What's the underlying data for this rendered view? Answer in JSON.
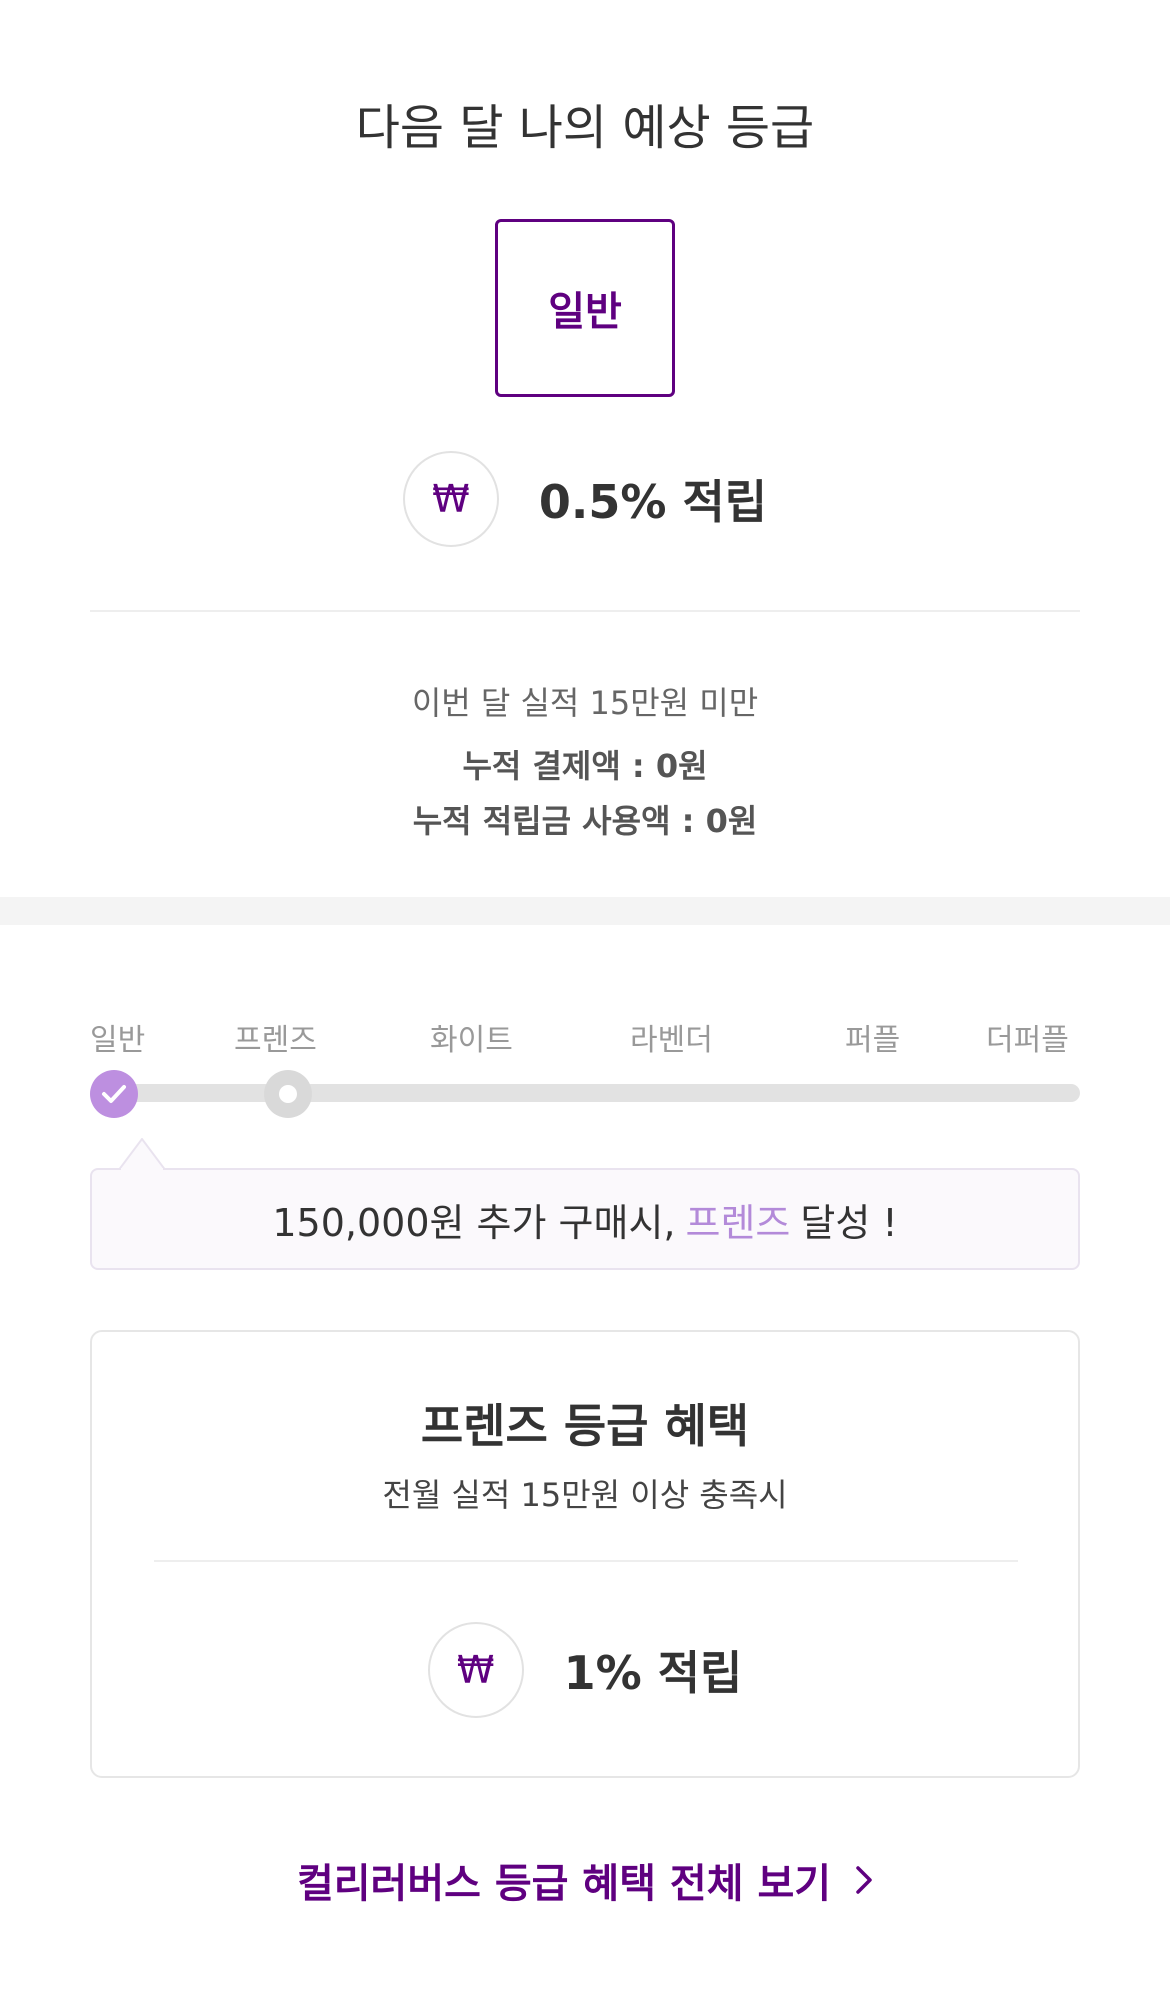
{
  "header": {
    "title": "다음 달 나의 예상 등급",
    "grade": "일반",
    "reward_icon": "won-icon",
    "reward_symbol": "₩",
    "reward_text": "0.5% 적립"
  },
  "summary": {
    "performance": "이번 달 실적 15만원 미만",
    "accumulated_payment": "누적 결제액 : 0원",
    "accumulated_points_used": "누적 적립금 사용액 : 0원"
  },
  "progress": {
    "tiers": [
      "일반",
      "프렌즈",
      "화이트",
      "라벤더",
      "퍼플",
      "더퍼플"
    ],
    "current_tier": "일반",
    "next_tier": "프렌즈",
    "message_prefix": "150,000원 추가 구매시,",
    "message_tier": "프렌즈",
    "message_suffix": "달성 !"
  },
  "benefit": {
    "title": "프렌즈 등급 혜택",
    "condition": "전월 실적 15만원 이상 충족시",
    "reward_symbol": "₩",
    "reward_text": "1% 적립"
  },
  "footer": {
    "link_label": "컬리러버스 등급 혜택 전체 보기",
    "link_icon": "chevron-right-icon"
  },
  "colors": {
    "brand_purple": "#5f0080",
    "accent_lavender": "#bd8fe0",
    "highlight_text": "#b38ad9",
    "track_gray": "#e2e2e2"
  }
}
